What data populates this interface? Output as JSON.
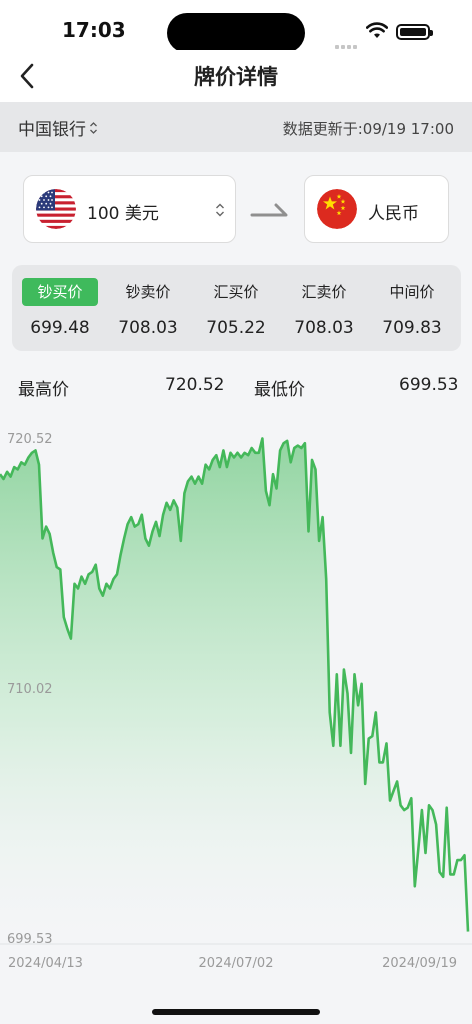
{
  "status": {
    "time": "17:03"
  },
  "nav": {
    "title": "牌价详情"
  },
  "bank": {
    "name": "中国银行",
    "update": "数据更新于:09/19 17:00"
  },
  "from_currency": {
    "label": "100 美元",
    "flag": "us-flag-icon"
  },
  "to_currency": {
    "label": "人民币",
    "flag": "cn-flag-icon"
  },
  "prices": [
    {
      "label": "钞买价",
      "value": "699.48",
      "active": true
    },
    {
      "label": "钞卖价",
      "value": "708.03",
      "active": false
    },
    {
      "label": "汇买价",
      "value": "705.22",
      "active": false
    },
    {
      "label": "汇卖价",
      "value": "708.03",
      "active": false
    },
    {
      "label": "中间价",
      "value": "709.83",
      "active": false
    }
  ],
  "highlow": {
    "high_label": "最高价",
    "high_value": "720.52",
    "low_label": "最低价",
    "low_value": "699.53"
  },
  "colors": {
    "accent": "#3fba5c",
    "line": "#44b85a"
  },
  "chart_data": {
    "type": "area",
    "title": "",
    "xlabel": "",
    "ylabel": "",
    "ylim": [
      699.53,
      720.52
    ],
    "y_ticks": [
      "720.52",
      "710.02",
      "699.53"
    ],
    "x_ticks": [
      "2024/04/13",
      "2024/07/02",
      "2024/09/19"
    ],
    "series": [
      {
        "values": [
          719.0,
          718.8,
          719.1,
          718.9,
          719.3,
          719.2,
          719.5,
          719.4,
          719.7,
          719.9,
          720.0,
          719.4,
          716.3,
          716.8,
          716.5,
          715.7,
          715.1,
          715.0,
          713.0,
          712.5,
          712.1,
          714.4,
          714.2,
          714.7,
          714.4,
          714.8,
          714.9,
          715.2,
          714.2,
          713.9,
          714.4,
          714.2,
          714.6,
          714.8,
          715.6,
          716.3,
          716.9,
          717.2,
          716.8,
          716.9,
          717.3,
          716.3,
          716.0,
          716.6,
          717.0,
          716.4,
          717.3,
          717.8,
          717.5,
          717.9,
          717.6,
          716.2,
          718.2,
          718.7,
          718.9,
          718.6,
          718.9,
          718.6,
          719.4,
          719.2,
          719.6,
          719.8,
          719.3,
          720.0,
          719.3,
          719.9,
          719.7,
          719.9,
          719.7,
          719.9,
          719.8,
          720.1,
          719.9,
          719.9,
          720.5,
          718.3,
          717.7,
          719.0,
          718.4,
          720.0,
          720.3,
          720.4,
          719.5,
          720.1,
          720.2,
          720.1,
          720.3,
          716.6,
          719.6,
          719.2,
          716.2,
          717.2,
          714.6,
          709.0,
          707.6,
          710.6,
          707.6,
          710.8,
          709.8,
          707.3,
          710.6,
          709.3,
          710.2,
          706.0,
          707.9,
          708.0,
          709.0,
          706.9,
          706.9,
          707.7,
          705.3,
          705.7,
          706.1,
          705.1,
          704.9,
          705.0,
          705.4,
          701.7,
          703.3,
          704.9,
          703.1,
          705.1,
          704.9,
          704.3,
          702.3,
          702.1,
          705.0,
          702.2,
          702.2,
          702.8,
          702.8,
          703.0,
          699.8
        ]
      }
    ]
  }
}
